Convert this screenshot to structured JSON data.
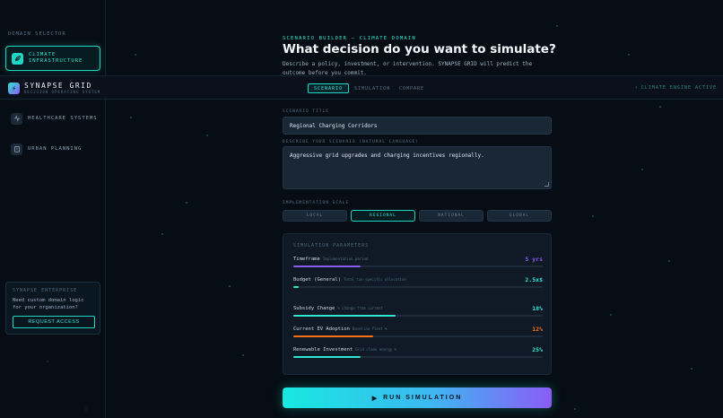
{
  "sidebar": {
    "section_label": "DOMAIN SELECTOR",
    "domains": [
      {
        "label": "CLIMATE INFRASTRUCTURE",
        "icon": "leaf-icon",
        "active": true
      },
      {
        "label": "HEALTHCARE SYSTEMS",
        "icon": "pulse-icon",
        "active": false
      },
      {
        "label": "URBAN PLANNING",
        "icon": "building-icon",
        "active": false
      }
    ],
    "enterprise": {
      "title": "SYNAPSE ENTERPRISE",
      "text": "Need custom domain logic for your organization?",
      "button": "REQUEST ACCESS"
    }
  },
  "topbar": {
    "brand": "SYNAPSE GRID",
    "tagline": "DECISION OPERATING SYSTEM",
    "tabs": [
      {
        "label": "SCENARIO",
        "active": true
      },
      {
        "label": "SIMULATION",
        "active": false
      },
      {
        "label": "COMPARE",
        "active": false
      }
    ],
    "status": "CLIMATE ENGINE ACTIVE"
  },
  "main": {
    "eyebrow": "SCENARIO BUILDER — CLIMATE DOMAIN",
    "headline": "What decision do you want to simulate?",
    "lead": "Describe a policy, investment, or intervention. SYNAPSE GRID will predict the outcome before you commit.",
    "title_label": "SCENARIO TITLE",
    "title_value": "Regional Charging Corridors",
    "desc_label": "DESCRIBE YOUR SCENARIO (natural language)",
    "desc_value": "Aggressive grid upgrades and charging incentives regionally.",
    "scale_label": "IMPLEMENTATION SCALE",
    "scales": [
      {
        "label": "LOCAL",
        "active": false
      },
      {
        "label": "REGIONAL",
        "active": true
      },
      {
        "label": "NATIONAL",
        "active": false
      },
      {
        "label": "GLOBAL",
        "active": false
      }
    ]
  },
  "params": {
    "title": "SIMULATION PARAMETERS",
    "items": [
      {
        "name": "Timeframe",
        "hint": "Implementation period",
        "value": "5 yrs",
        "level": 0.27,
        "color": "#8b5cf6"
      },
      {
        "name": "Budget (General)",
        "hint": "Total tax-specific allocation",
        "value": "2.5x$",
        "level": 0.02,
        "color": "#2fe6d2"
      },
      {
        "name": "Subsidy Change",
        "hint": "% change from current",
        "value": "18%",
        "level": 0.41,
        "color": "#2fe6d2"
      },
      {
        "name": "Current EV Adoption",
        "hint": "Baseline fleet %",
        "value": "12%",
        "level": 0.32,
        "color": "#f97316"
      },
      {
        "name": "Renewable Investment",
        "hint": "Grid clean energy %",
        "value": "25%",
        "level": 0.27,
        "color": "#2fe6d2"
      }
    ]
  },
  "run_button": "RUN SIMULATION"
}
